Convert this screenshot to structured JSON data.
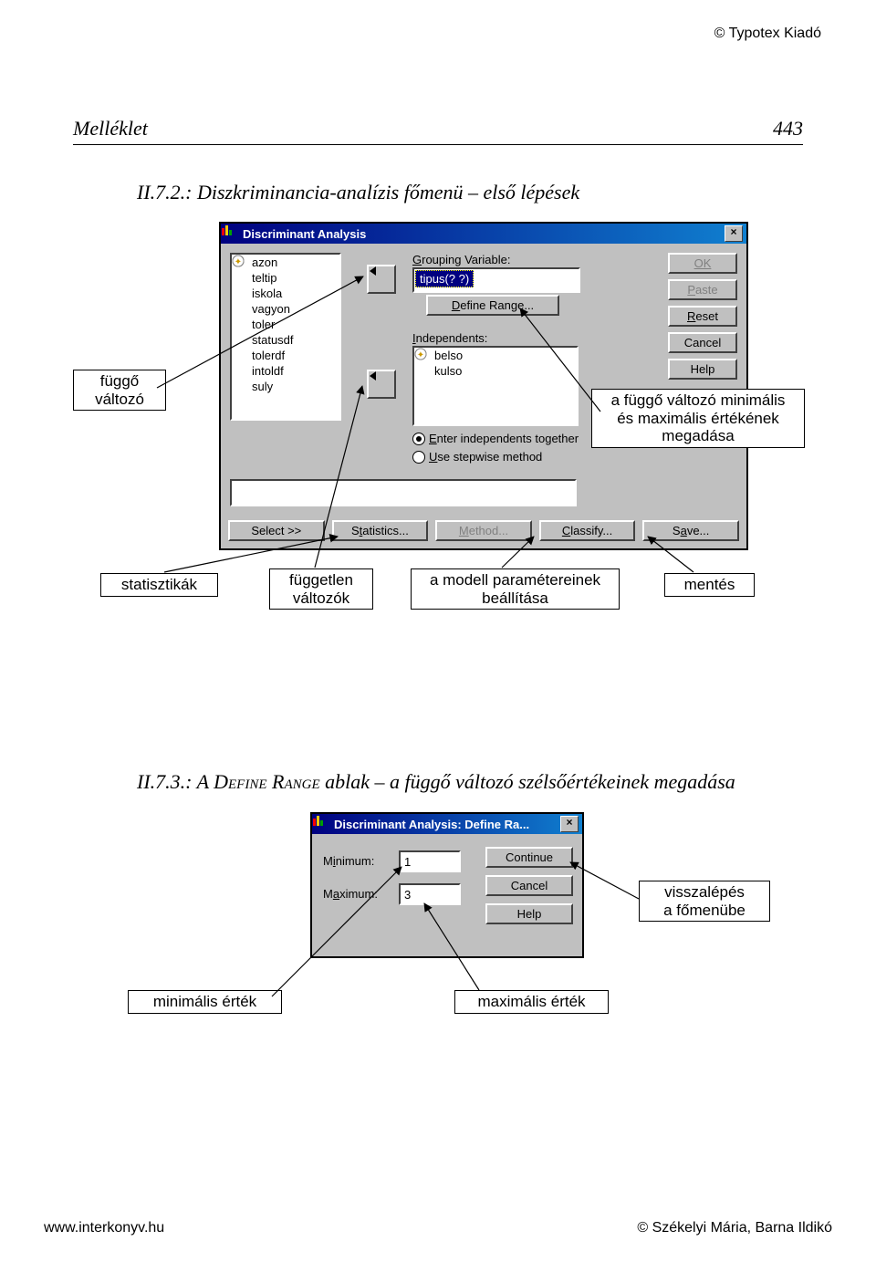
{
  "publisher": "© Typotex Kiadó",
  "header": {
    "title": "Melléklet",
    "page": "443"
  },
  "caption1": "II.7.2.: Diszkriminancia-analízis főmenü – első lépések",
  "caption2_num": "II.7.3.: A ",
  "caption2_smallcaps": "Define Range",
  "caption2_rest": " ablak – a függő változó szélsőértékeinek megadása",
  "footer": {
    "left": "www.interkonyv.hu",
    "right": "© Székelyi Mária, Barna Ildikó"
  },
  "callouts": {
    "dep": "függő\nváltozó",
    "range": "a függő változó minimális\nés maximális értékének\nmegadása",
    "stats": "statisztikák",
    "indep": "független\nváltozók",
    "model": "a modell paramétereinek\nbeállítása",
    "save": "mentés",
    "back": "visszalépés\na főmenübe",
    "minval": "minimális érték",
    "maxval": "maximális érték"
  },
  "dlg1": {
    "title": "Discriminant Analysis",
    "close": "×",
    "vars": [
      "azon",
      "teltip",
      "iskola",
      "vagyon",
      "toler",
      "statusdf",
      "tolerdf",
      "intoldf",
      "suly"
    ],
    "grouping_label": "Grouping Variable:",
    "grouping_value": "tipus(? ?)",
    "define_range": "Define Range...",
    "independents_label": "Independents:",
    "independents": [
      "belso",
      "kulso"
    ],
    "radio_enter": "Enter independents together",
    "radio_step": "Use stepwise method",
    "buttons_right": [
      "OK",
      "Paste",
      "Reset",
      "Cancel",
      "Help"
    ],
    "buttons_bottom": [
      "Select >>",
      "Statistics...",
      "Method...",
      "Classify...",
      "Save..."
    ]
  },
  "dlg2": {
    "title": "Discriminant Analysis: Define Ra...",
    "close": "×",
    "min_label": "Minimum:",
    "max_label": "Maximum:",
    "min_val": "1",
    "max_val": "3",
    "buttons": [
      "Continue",
      "Cancel",
      "Help"
    ]
  }
}
